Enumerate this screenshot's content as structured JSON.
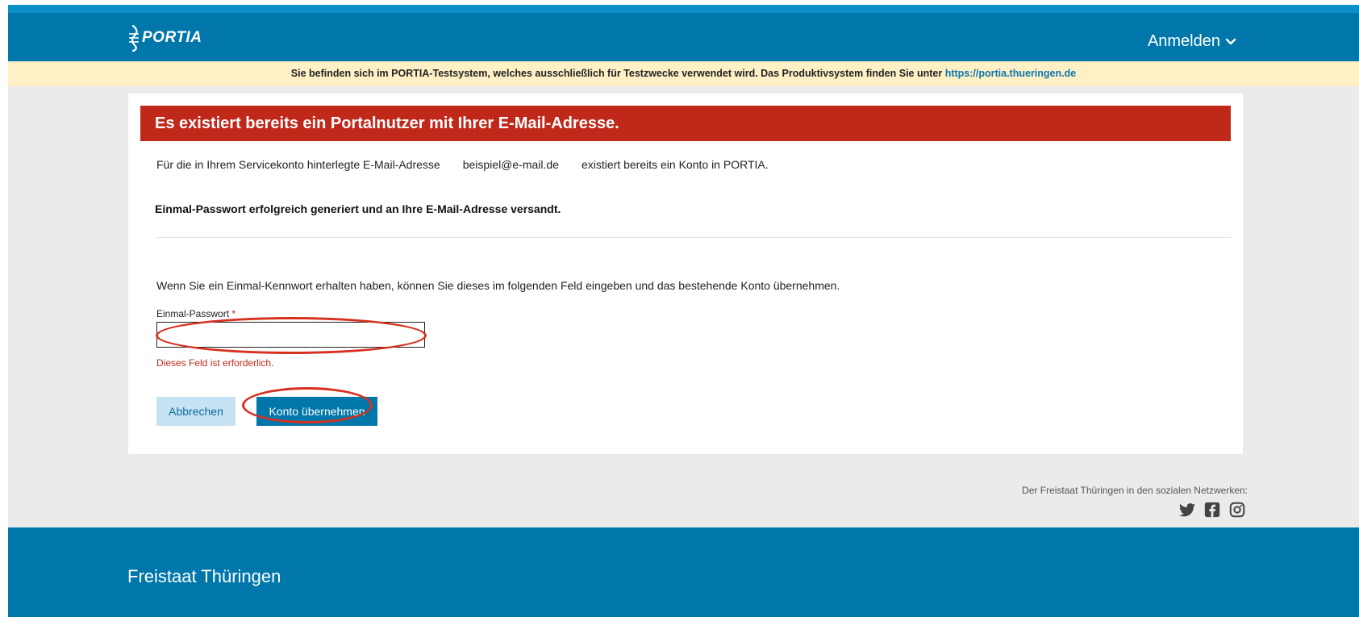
{
  "header": {
    "logo_text": "PORTIA",
    "login_label": "Anmelden"
  },
  "notice": {
    "text": "Sie befinden sich im PORTIA-Testsystem, welches ausschließlich für Testzwecke verwendet wird. Das Produktivsystem finden Sie unter",
    "link": "https://portia.thueringen.de"
  },
  "alert": {
    "title": "Es existiert bereits ein Portalnutzer mit Ihrer E-Mail-Adresse."
  },
  "content": {
    "line1_prefix": "Für die in Ihrem Servicekonto hinterlegte E-Mail-Adresse",
    "email": "beispiel@e-mail.de",
    "line1_suffix": "existiert bereits ein Konto in PORTIA.",
    "success_message": "Einmal-Passwort erfolgreich generiert und an Ihre E-Mail-Adresse versandt.",
    "instruction": "Wenn Sie ein Einmal-Kennwort erhalten haben, können Sie dieses im folgenden Feld eingeben und das bestehende Konto übernehmen."
  },
  "form": {
    "password_label": "Einmal-Passwort",
    "required_marker": "*",
    "password_value": "",
    "error_message": "Dieses Feld ist erforderlich.",
    "cancel_label": "Abbrechen",
    "submit_label": "Konto übernehmen"
  },
  "social": {
    "text": "Der Freistaat Thüringen in den sozialen Netzwerken:",
    "icons": [
      "twitter-icon",
      "facebook-icon",
      "instagram-icon"
    ]
  },
  "footer": {
    "title": "Freistaat Thüringen"
  },
  "colors": {
    "primary": "#0077aa",
    "alert": "#c0281a",
    "notice_bg": "#fff0c6",
    "annotation": "#d6301f"
  }
}
